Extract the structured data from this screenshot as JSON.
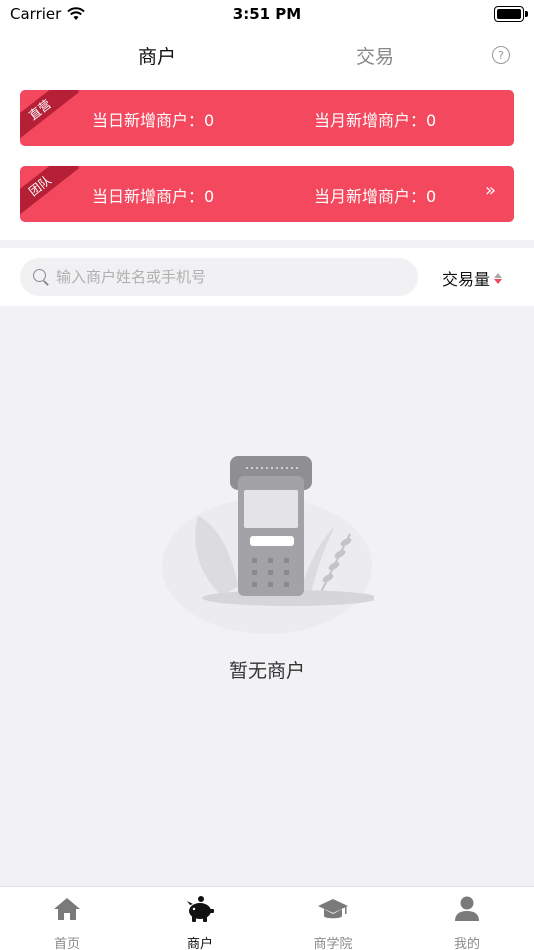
{
  "status_bar": {
    "carrier": "Carrier",
    "time": "3:51 PM"
  },
  "top_tabs": {
    "merchant": "商户",
    "transaction": "交易",
    "help_symbol": "?"
  },
  "cards": [
    {
      "ribbon": "直营",
      "daily_label": "当日新增商户：",
      "daily_value": "0",
      "monthly_label": "当月新增商户：",
      "monthly_value": "0"
    },
    {
      "ribbon": "团队",
      "daily_label": "当日新增商户：",
      "daily_value": "0",
      "monthly_label": "当月新增商户：",
      "monthly_value": "0",
      "arrow": "»"
    }
  ],
  "search": {
    "placeholder": "输入商户姓名或手机号",
    "value": ""
  },
  "sort": {
    "label": "交易量"
  },
  "empty": {
    "message": "暂无商户"
  },
  "tab_bar": [
    {
      "label": "首页",
      "icon": "home-icon",
      "active": false
    },
    {
      "label": "商户",
      "icon": "piggy-bank-icon",
      "active": true
    },
    {
      "label": "商学院",
      "icon": "graduation-cap-icon",
      "active": false
    },
    {
      "label": "我的",
      "icon": "user-icon",
      "active": false
    }
  ],
  "colors": {
    "accent": "#f4485e",
    "ribbon": "#b52036",
    "background_gray": "#f2f2f5"
  }
}
